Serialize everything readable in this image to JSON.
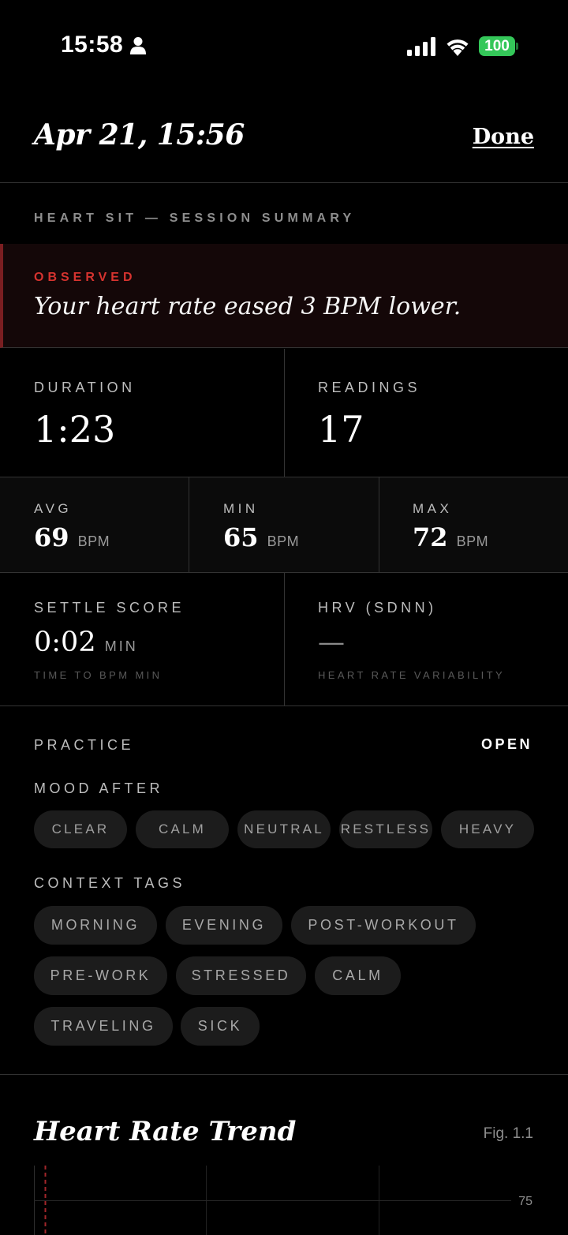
{
  "status_bar": {
    "time": "15:58",
    "battery": "100",
    "battery_color": "#34c759"
  },
  "header": {
    "title": "Apr 21, 15:56",
    "done_label": "Done"
  },
  "session": {
    "section_label": "HEART SIT — SESSION SUMMARY"
  },
  "observed": {
    "label": "OBSERVED",
    "text": "Your heart rate eased 3 BPM lower.",
    "accent_color": "#d6332f"
  },
  "stats": {
    "duration": {
      "label": "DURATION",
      "value": "1:23"
    },
    "readings": {
      "label": "READINGS",
      "value": "17"
    },
    "avg": {
      "label": "AVG",
      "value": "69",
      "unit": "BPM"
    },
    "min": {
      "label": "MIN",
      "value": "65",
      "unit": "BPM"
    },
    "max": {
      "label": "MAX",
      "value": "72",
      "unit": "BPM"
    },
    "settle": {
      "label": "SETTLE SCORE",
      "value": "0:02",
      "unit": "MIN",
      "sub": "TIME TO BPM MIN"
    },
    "hrv": {
      "label": "HRV (SDNN)",
      "value": "—",
      "sub": "HEART RATE VARIABILITY"
    }
  },
  "practice": {
    "label": "PRACTICE",
    "toggle_label": "OPEN",
    "mood_label": "MOOD AFTER",
    "moods": [
      "CLEAR",
      "CALM",
      "NEUTRAL",
      "RESTLESS",
      "HEAVY"
    ],
    "context_label": "CONTEXT TAGS",
    "tags": [
      "MORNING",
      "EVENING",
      "POST-WORKOUT",
      "PRE-WORK",
      "STRESSED",
      "CALM",
      "TRAVELING",
      "SICK"
    ]
  },
  "trend": {
    "title": "Heart Rate Trend",
    "fig_label": "Fig. 1.1",
    "y_tick": "75"
  }
}
